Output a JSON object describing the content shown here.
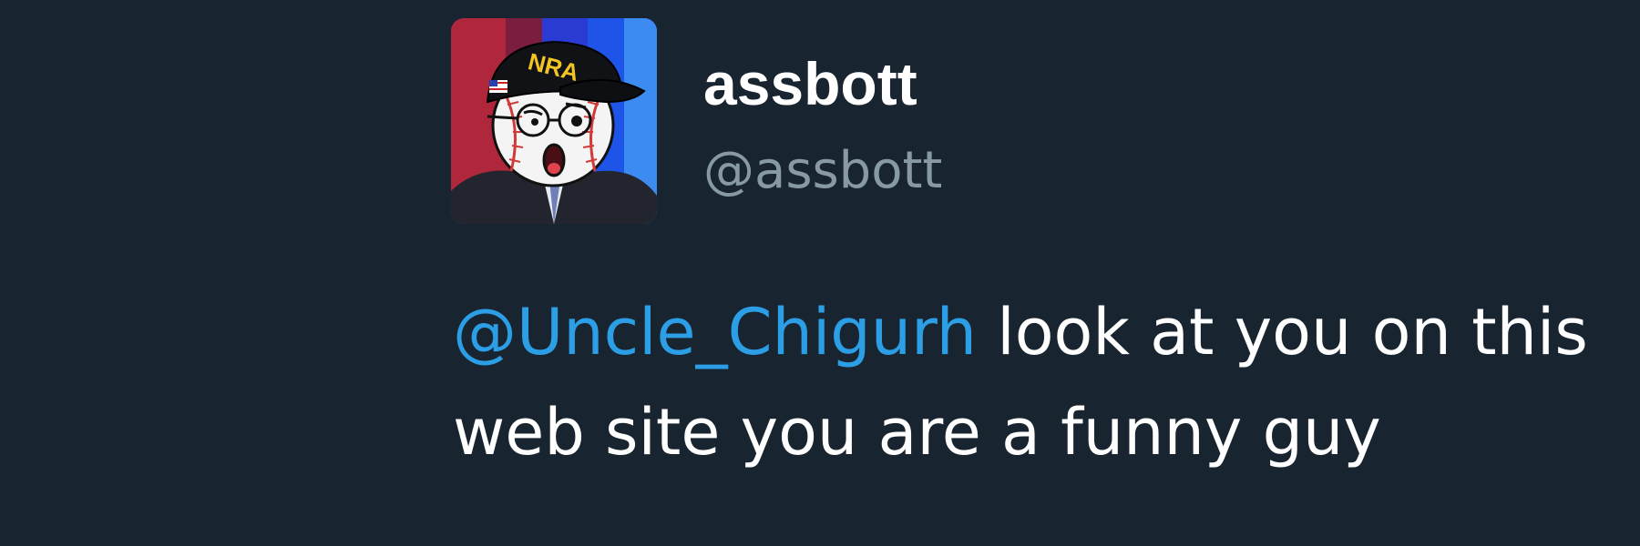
{
  "tweet": {
    "author": {
      "display_name": "assbott",
      "handle": "@assbott",
      "avatar_icon": "baseball-head-cartoon-avatar",
      "cap_text": "NRA"
    },
    "text": {
      "mention": "@Uncle_Chigurh",
      "line1_rest": " look at you on this",
      "line2": "web site you are a funny guy"
    }
  },
  "colors": {
    "background": "#18242f",
    "display_name": "#ffffff",
    "handle": "#8899a6",
    "text": "#ffffff",
    "mention": "#2b9ee6"
  }
}
